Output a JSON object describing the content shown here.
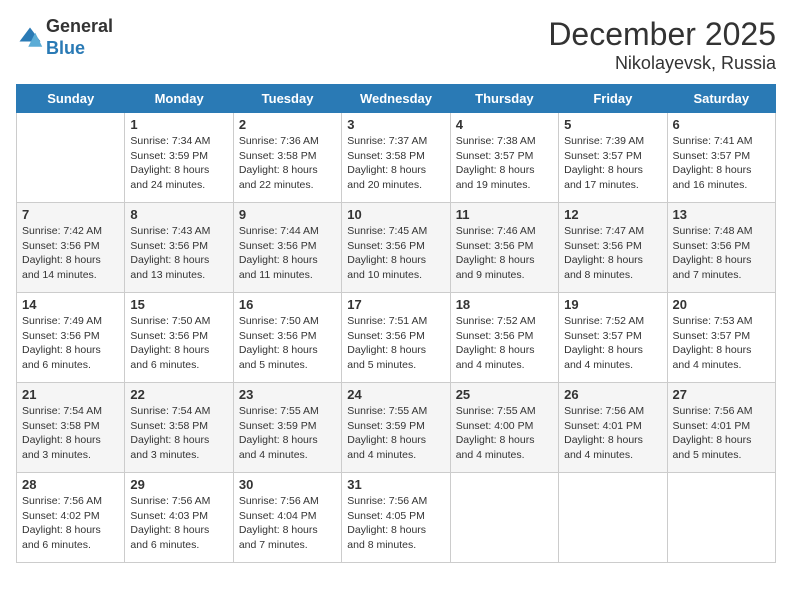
{
  "header": {
    "logo_general": "General",
    "logo_blue": "Blue",
    "title": "December 2025",
    "subtitle": "Nikolayevsk, Russia"
  },
  "days": [
    "Sunday",
    "Monday",
    "Tuesday",
    "Wednesday",
    "Thursday",
    "Friday",
    "Saturday"
  ],
  "weeks": [
    [
      {
        "date": "",
        "sunrise": "",
        "sunset": "",
        "daylight": ""
      },
      {
        "date": "1",
        "sunrise": "Sunrise: 7:34 AM",
        "sunset": "Sunset: 3:59 PM",
        "daylight": "Daylight: 8 hours and 24 minutes."
      },
      {
        "date": "2",
        "sunrise": "Sunrise: 7:36 AM",
        "sunset": "Sunset: 3:58 PM",
        "daylight": "Daylight: 8 hours and 22 minutes."
      },
      {
        "date": "3",
        "sunrise": "Sunrise: 7:37 AM",
        "sunset": "Sunset: 3:58 PM",
        "daylight": "Daylight: 8 hours and 20 minutes."
      },
      {
        "date": "4",
        "sunrise": "Sunrise: 7:38 AM",
        "sunset": "Sunset: 3:57 PM",
        "daylight": "Daylight: 8 hours and 19 minutes."
      },
      {
        "date": "5",
        "sunrise": "Sunrise: 7:39 AM",
        "sunset": "Sunset: 3:57 PM",
        "daylight": "Daylight: 8 hours and 17 minutes."
      },
      {
        "date": "6",
        "sunrise": "Sunrise: 7:41 AM",
        "sunset": "Sunset: 3:57 PM",
        "daylight": "Daylight: 8 hours and 16 minutes."
      }
    ],
    [
      {
        "date": "7",
        "sunrise": "Sunrise: 7:42 AM",
        "sunset": "Sunset: 3:56 PM",
        "daylight": "Daylight: 8 hours and 14 minutes."
      },
      {
        "date": "8",
        "sunrise": "Sunrise: 7:43 AM",
        "sunset": "Sunset: 3:56 PM",
        "daylight": "Daylight: 8 hours and 13 minutes."
      },
      {
        "date": "9",
        "sunrise": "Sunrise: 7:44 AM",
        "sunset": "Sunset: 3:56 PM",
        "daylight": "Daylight: 8 hours and 11 minutes."
      },
      {
        "date": "10",
        "sunrise": "Sunrise: 7:45 AM",
        "sunset": "Sunset: 3:56 PM",
        "daylight": "Daylight: 8 hours and 10 minutes."
      },
      {
        "date": "11",
        "sunrise": "Sunrise: 7:46 AM",
        "sunset": "Sunset: 3:56 PM",
        "daylight": "Daylight: 8 hours and 9 minutes."
      },
      {
        "date": "12",
        "sunrise": "Sunrise: 7:47 AM",
        "sunset": "Sunset: 3:56 PM",
        "daylight": "Daylight: 8 hours and 8 minutes."
      },
      {
        "date": "13",
        "sunrise": "Sunrise: 7:48 AM",
        "sunset": "Sunset: 3:56 PM",
        "daylight": "Daylight: 8 hours and 7 minutes."
      }
    ],
    [
      {
        "date": "14",
        "sunrise": "Sunrise: 7:49 AM",
        "sunset": "Sunset: 3:56 PM",
        "daylight": "Daylight: 8 hours and 6 minutes."
      },
      {
        "date": "15",
        "sunrise": "Sunrise: 7:50 AM",
        "sunset": "Sunset: 3:56 PM",
        "daylight": "Daylight: 8 hours and 6 minutes."
      },
      {
        "date": "16",
        "sunrise": "Sunrise: 7:50 AM",
        "sunset": "Sunset: 3:56 PM",
        "daylight": "Daylight: 8 hours and 5 minutes."
      },
      {
        "date": "17",
        "sunrise": "Sunrise: 7:51 AM",
        "sunset": "Sunset: 3:56 PM",
        "daylight": "Daylight: 8 hours and 5 minutes."
      },
      {
        "date": "18",
        "sunrise": "Sunrise: 7:52 AM",
        "sunset": "Sunset: 3:56 PM",
        "daylight": "Daylight: 8 hours and 4 minutes."
      },
      {
        "date": "19",
        "sunrise": "Sunrise: 7:52 AM",
        "sunset": "Sunset: 3:57 PM",
        "daylight": "Daylight: 8 hours and 4 minutes."
      },
      {
        "date": "20",
        "sunrise": "Sunrise: 7:53 AM",
        "sunset": "Sunset: 3:57 PM",
        "daylight": "Daylight: 8 hours and 4 minutes."
      }
    ],
    [
      {
        "date": "21",
        "sunrise": "Sunrise: 7:54 AM",
        "sunset": "Sunset: 3:58 PM",
        "daylight": "Daylight: 8 hours and 3 minutes."
      },
      {
        "date": "22",
        "sunrise": "Sunrise: 7:54 AM",
        "sunset": "Sunset: 3:58 PM",
        "daylight": "Daylight: 8 hours and 3 minutes."
      },
      {
        "date": "23",
        "sunrise": "Sunrise: 7:55 AM",
        "sunset": "Sunset: 3:59 PM",
        "daylight": "Daylight: 8 hours and 4 minutes."
      },
      {
        "date": "24",
        "sunrise": "Sunrise: 7:55 AM",
        "sunset": "Sunset: 3:59 PM",
        "daylight": "Daylight: 8 hours and 4 minutes."
      },
      {
        "date": "25",
        "sunrise": "Sunrise: 7:55 AM",
        "sunset": "Sunset: 4:00 PM",
        "daylight": "Daylight: 8 hours and 4 minutes."
      },
      {
        "date": "26",
        "sunrise": "Sunrise: 7:56 AM",
        "sunset": "Sunset: 4:01 PM",
        "daylight": "Daylight: 8 hours and 4 minutes."
      },
      {
        "date": "27",
        "sunrise": "Sunrise: 7:56 AM",
        "sunset": "Sunset: 4:01 PM",
        "daylight": "Daylight: 8 hours and 5 minutes."
      }
    ],
    [
      {
        "date": "28",
        "sunrise": "Sunrise: 7:56 AM",
        "sunset": "Sunset: 4:02 PM",
        "daylight": "Daylight: 8 hours and 6 minutes."
      },
      {
        "date": "29",
        "sunrise": "Sunrise: 7:56 AM",
        "sunset": "Sunset: 4:03 PM",
        "daylight": "Daylight: 8 hours and 6 minutes."
      },
      {
        "date": "30",
        "sunrise": "Sunrise: 7:56 AM",
        "sunset": "Sunset: 4:04 PM",
        "daylight": "Daylight: 8 hours and 7 minutes."
      },
      {
        "date": "31",
        "sunrise": "Sunrise: 7:56 AM",
        "sunset": "Sunset: 4:05 PM",
        "daylight": "Daylight: 8 hours and 8 minutes."
      },
      {
        "date": "",
        "sunrise": "",
        "sunset": "",
        "daylight": ""
      },
      {
        "date": "",
        "sunrise": "",
        "sunset": "",
        "daylight": ""
      },
      {
        "date": "",
        "sunrise": "",
        "sunset": "",
        "daylight": ""
      }
    ]
  ]
}
